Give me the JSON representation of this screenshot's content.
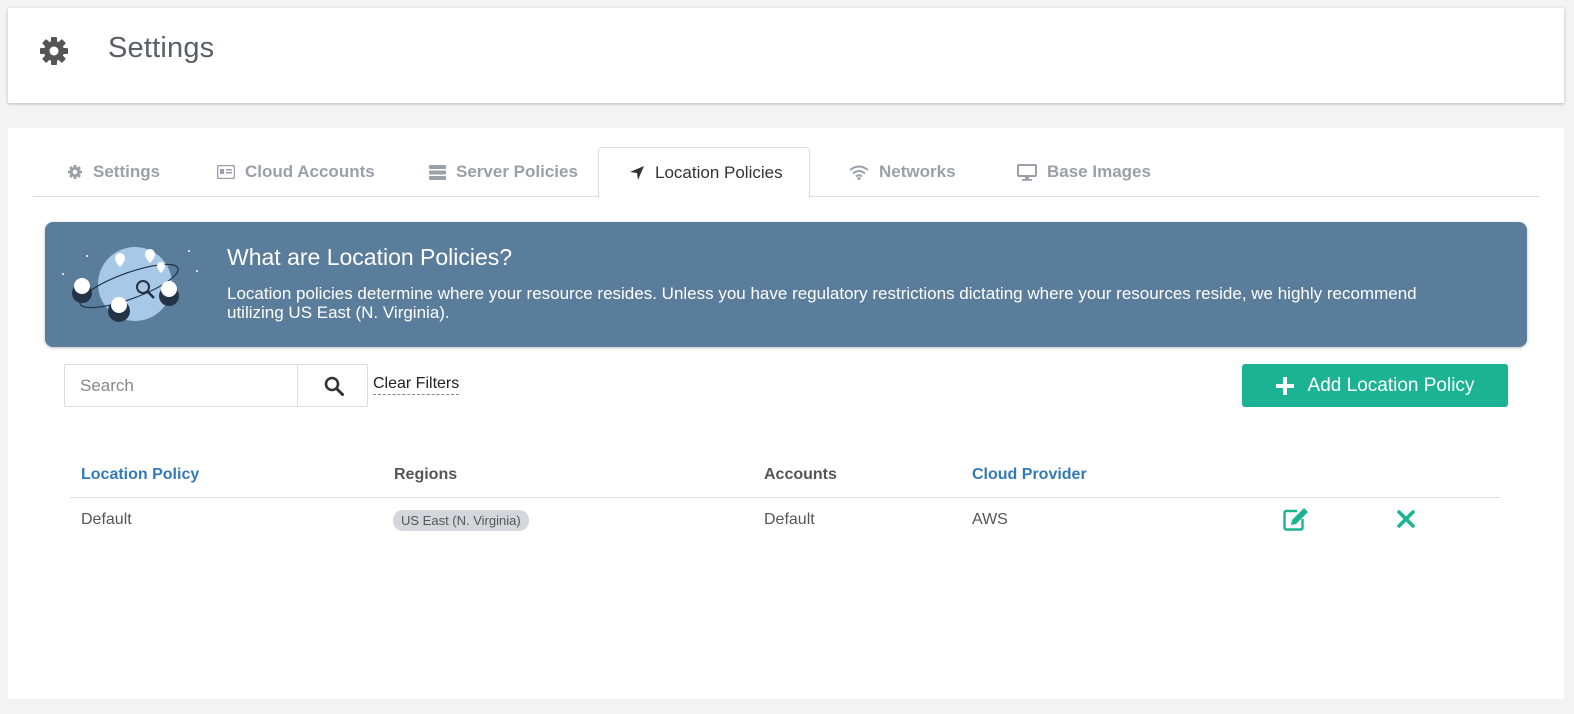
{
  "header": {
    "title": "Settings",
    "icon": "gear-icon"
  },
  "tabs": [
    {
      "label": "Settings",
      "icon": "gear-icon",
      "active": false
    },
    {
      "label": "Cloud Accounts",
      "icon": "id-card-icon",
      "active": false
    },
    {
      "label": "Server Policies",
      "icon": "server-icon",
      "active": false
    },
    {
      "label": "Location Policies",
      "icon": "location-arrow-icon",
      "active": true
    },
    {
      "label": "Networks",
      "icon": "wifi-icon",
      "active": false
    },
    {
      "label": "Base Images",
      "icon": "monitor-icon",
      "active": false
    }
  ],
  "banner": {
    "title": "What are Location Policies?",
    "description": "Location policies determine where your resource resides. Unless you have regulatory restrictions dictating where your resources reside, we highly recommend utilizing US East (N. Virginia)."
  },
  "toolbar": {
    "search_placeholder": "Search",
    "search_value": "",
    "clear_filters": "Clear Filters",
    "add_button": "Add Location Policy"
  },
  "table": {
    "columns": [
      "Location Policy",
      "Regions",
      "Accounts",
      "Cloud Provider"
    ],
    "rows": [
      {
        "policy": "Default",
        "region": "US East (N. Virginia)",
        "accounts": "Default",
        "provider": "AWS"
      }
    ]
  },
  "colors": {
    "accent": "#1bb394",
    "banner": "#5b7d9c",
    "link": "#337ab7"
  }
}
